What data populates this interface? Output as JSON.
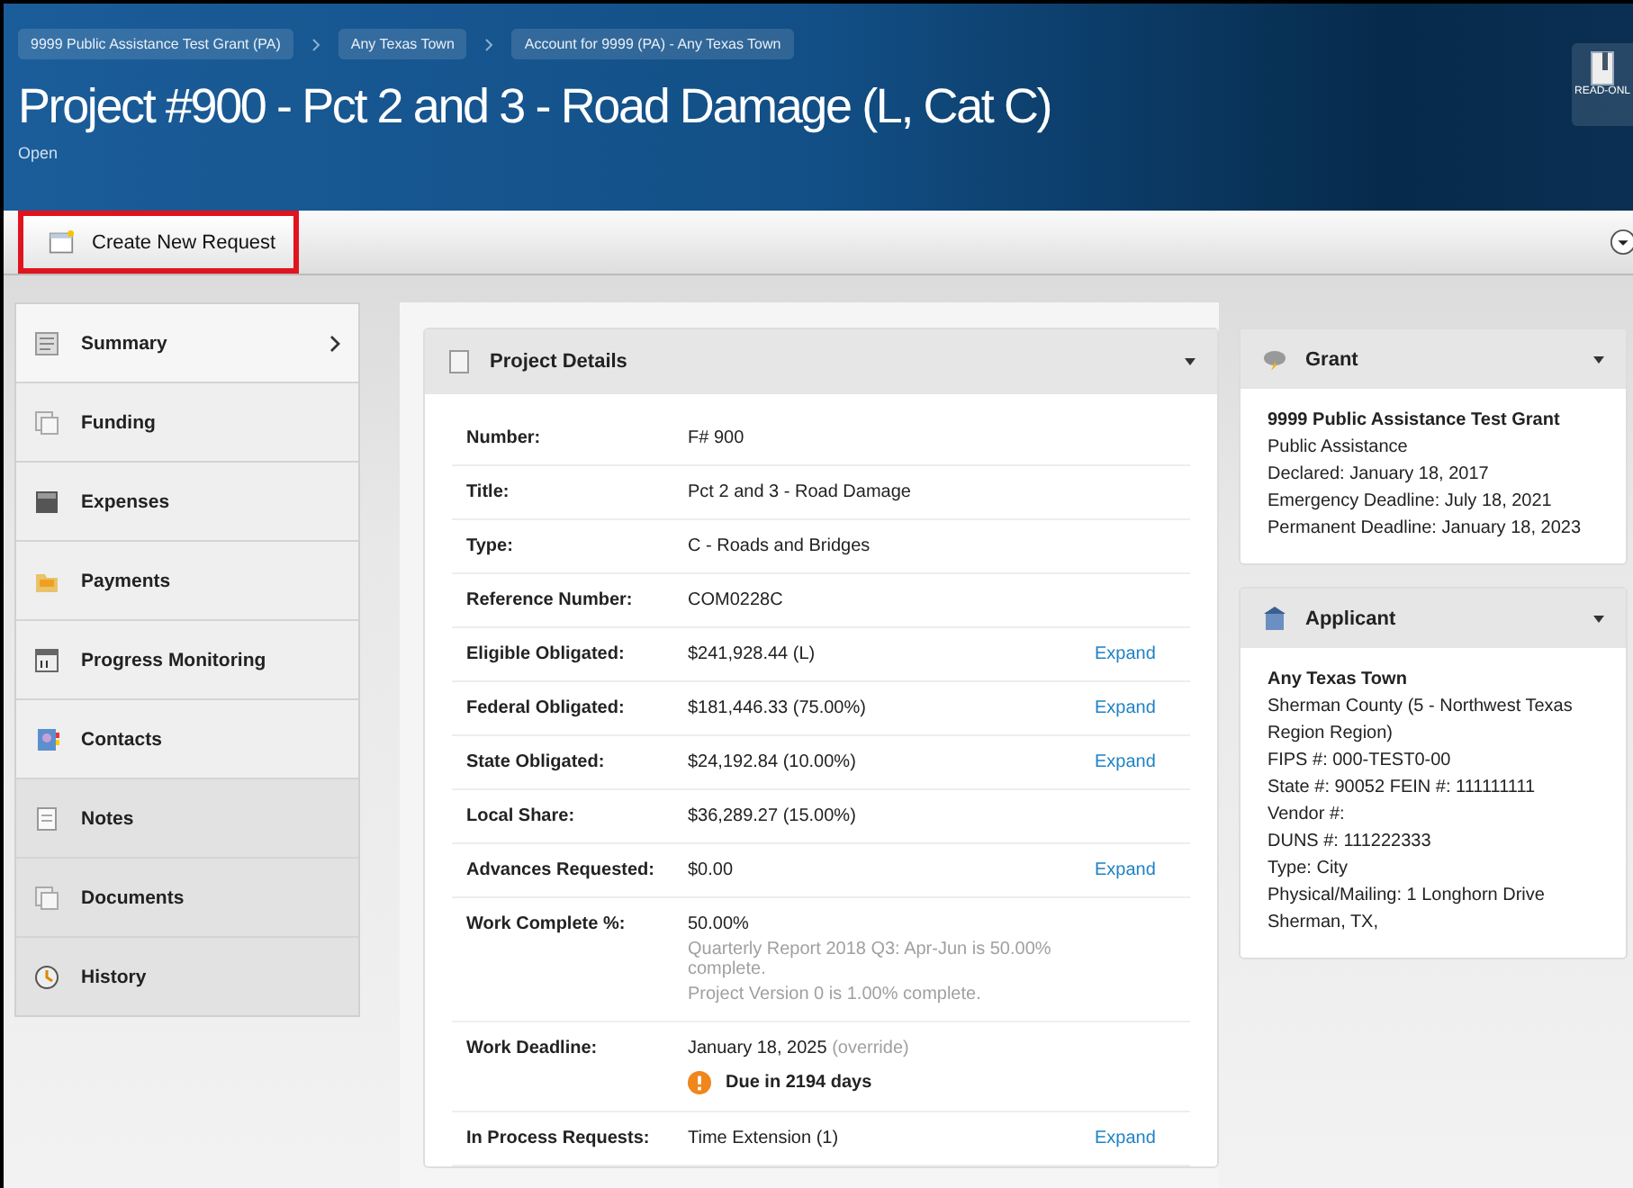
{
  "breadcrumbs": [
    "9999 Public Assistance Test Grant (PA)",
    "Any Texas Town",
    "Account for 9999 (PA) - Any Texas Town"
  ],
  "title": "Project #900 - Pct 2 and 3 - Road Damage (L, Cat C)",
  "status": "Open",
  "read_only_button": "READ-ONL",
  "toolbar": {
    "create_button": {
      "label": "Create New Request",
      "highlighted": true
    }
  },
  "sidebar": {
    "items": [
      {
        "label": "Summary",
        "selected": true,
        "disabled": false
      },
      {
        "label": "Funding",
        "selected": false,
        "disabled": false
      },
      {
        "label": "Expenses",
        "selected": false,
        "disabled": false
      },
      {
        "label": "Payments",
        "selected": false,
        "disabled": false
      },
      {
        "label": "Progress Monitoring",
        "selected": false,
        "disabled": false
      },
      {
        "label": "Contacts",
        "selected": false,
        "disabled": false
      },
      {
        "label": "Notes",
        "selected": false,
        "disabled": true
      },
      {
        "label": "Documents",
        "selected": false,
        "disabled": true
      },
      {
        "label": "History",
        "selected": false,
        "disabled": true
      }
    ]
  },
  "project_details": {
    "title": "Project Details",
    "rows": [
      {
        "label": "Number:",
        "value": "F# 900"
      },
      {
        "label": "Title:",
        "value": "Pct 2 and 3 - Road Damage"
      },
      {
        "label": "Type:",
        "value": "C - Roads and Bridges"
      },
      {
        "label": "Reference Number:",
        "value": "COM0228C"
      },
      {
        "label": "Eligible Obligated:",
        "value": "$241,928.44 (L)",
        "link": "Expand"
      },
      {
        "label": "Federal Obligated:",
        "value": "$181,446.33 (75.00%)",
        "link": "Expand"
      },
      {
        "label": "State Obligated:",
        "value": "$24,192.84 (10.00%)",
        "link": "Expand"
      },
      {
        "label": "Local Share:",
        "value": "$36,289.27 (15.00%)"
      },
      {
        "label": "Advances Requested:",
        "value": "$0.00",
        "link": "Expand"
      },
      {
        "label": "Work Complete %:",
        "value": "50.00%",
        "notes": [
          "Quarterly Report 2018 Q3: Apr-Jun is 50.00% complete.",
          "Project Version 0 is 1.00% complete."
        ]
      },
      {
        "label": "Work Deadline:",
        "value": "January 18, 2025",
        "value_note": "(override)",
        "alert": "Due in 2194 days"
      },
      {
        "label": "In Process Requests:",
        "value": "Time Extension (1)",
        "link": "Expand"
      }
    ]
  },
  "grant": {
    "title": "Grant",
    "name": "9999 Public Assistance Test Grant",
    "lines": [
      "Public Assistance",
      "Declared: January 18, 2017",
      "Emergency Deadline: July 18, 2021",
      "Permanent Deadline: January 18, 2023"
    ]
  },
  "applicant": {
    "title": "Applicant",
    "name": "Any Texas Town",
    "lines": [
      "Sherman County (5 - Northwest Texas Region Region)",
      "FIPS #: 000-TEST0-00",
      "State #: 90052 FEIN #: 111111111",
      "Vendor #:",
      "DUNS #: 111222333",
      "Type: City",
      "Physical/Mailing: 1 Longhorn Drive",
      "Sherman, TX,"
    ]
  }
}
